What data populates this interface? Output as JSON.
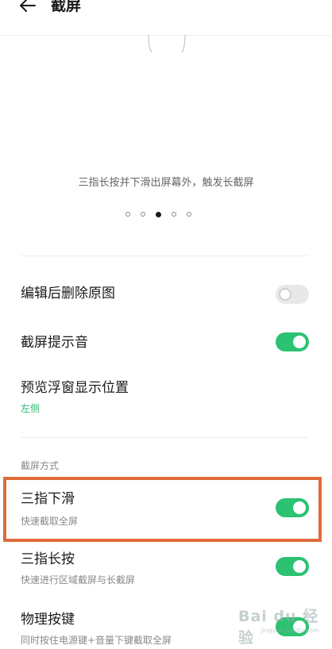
{
  "header": {
    "title": "截屏"
  },
  "preview": {
    "caption": "三指长按并下滑出屏幕外，触发长截屏",
    "page_count": 5,
    "active_page": 3
  },
  "settings": {
    "delete_original": {
      "title": "编辑后删除原图",
      "enabled": false
    },
    "sound": {
      "title": "截屏提示音",
      "enabled": true
    },
    "preview_position": {
      "title": "预览浮窗显示位置",
      "value": "左侧"
    }
  },
  "methods": {
    "section_label": "截屏方式",
    "items": [
      {
        "title": "三指下滑",
        "subtitle": "快速截取全屏",
        "enabled": true
      },
      {
        "title": "三指长按",
        "subtitle": "快速进行区域截屏与长截屏",
        "enabled": true
      },
      {
        "title": "物理按键",
        "subtitle": "同时按住电源键+音量下键截取全屏",
        "enabled": true
      }
    ]
  },
  "watermark": {
    "text": "Bai du 经验",
    "url": "jingyan.baidu.com"
  },
  "colors": {
    "accent": "#2bc272",
    "highlight": "#e06a3a"
  }
}
